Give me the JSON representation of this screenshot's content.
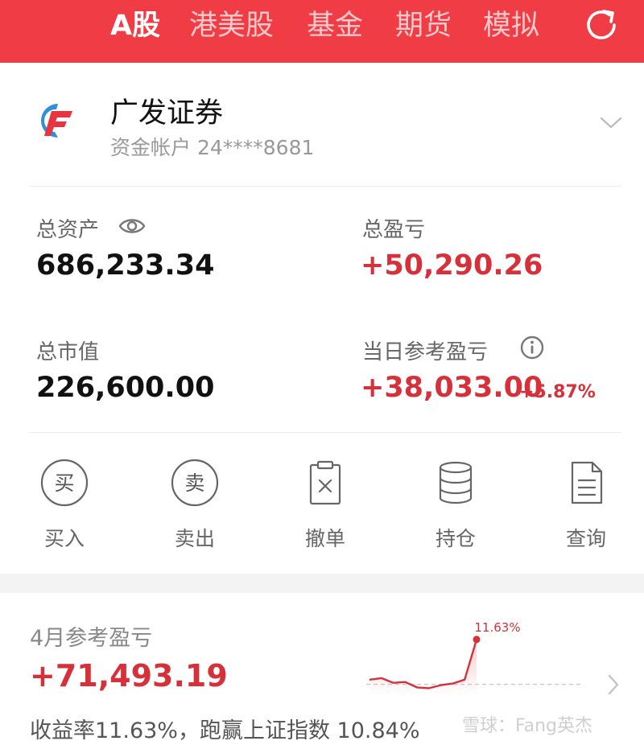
{
  "header": {
    "tabs": [
      {
        "label": "A股",
        "active": true
      },
      {
        "label": "港美股",
        "active": false
      },
      {
        "label": "基金",
        "active": false
      },
      {
        "label": "期货",
        "active": false
      },
      {
        "label": "模拟",
        "active": false
      }
    ],
    "refresh_icon": "refresh-icon",
    "color": "#ef3c45"
  },
  "account": {
    "broker": "广发证券",
    "account_label": "资金帐户 24****8681",
    "logo_icon": "gf-logo",
    "expand_icon": "chevron-down-icon"
  },
  "metrics": {
    "total_assets_label": "总资产",
    "total_assets_value": "686,233.34",
    "total_pnl_label": "总盈亏",
    "total_pnl_value": "+50,290.26",
    "market_value_label": "总市值",
    "market_value_value": "226,600.00",
    "daily_pnl_label": "当日参考盈亏",
    "daily_pnl_value": "+38,033.00",
    "daily_pnl_pct": "+5.87%",
    "up_color": "#d6303a"
  },
  "actions": [
    {
      "label": "买入",
      "glyph": "买",
      "icon": "buy-icon"
    },
    {
      "label": "卖出",
      "glyph": "卖",
      "icon": "sell-icon"
    },
    {
      "label": "撤单",
      "icon": "cancel-order-icon"
    },
    {
      "label": "持仓",
      "icon": "positions-icon"
    },
    {
      "label": "查询",
      "icon": "query-icon"
    }
  ],
  "monthly": {
    "label": "4月参考盈亏",
    "value": "+71,493.19",
    "summary": "收益率11.63%，跑赢上证指数 10.84%",
    "chart_peak_label": "11.63%"
  },
  "watermark": "雪球：Fang英杰",
  "chart_data": {
    "type": "area",
    "title": "",
    "xlabel": "",
    "ylabel": "",
    "series": [
      {
        "values": [
          1.2,
          1.6,
          0.4,
          0.6,
          -0.8,
          -1.0,
          -0.2,
          0.2,
          1.2,
          11.63
        ]
      }
    ],
    "ylim": [
      -3,
      12
    ],
    "baseline": 0,
    "grid": false,
    "annotation": "11.63%"
  }
}
